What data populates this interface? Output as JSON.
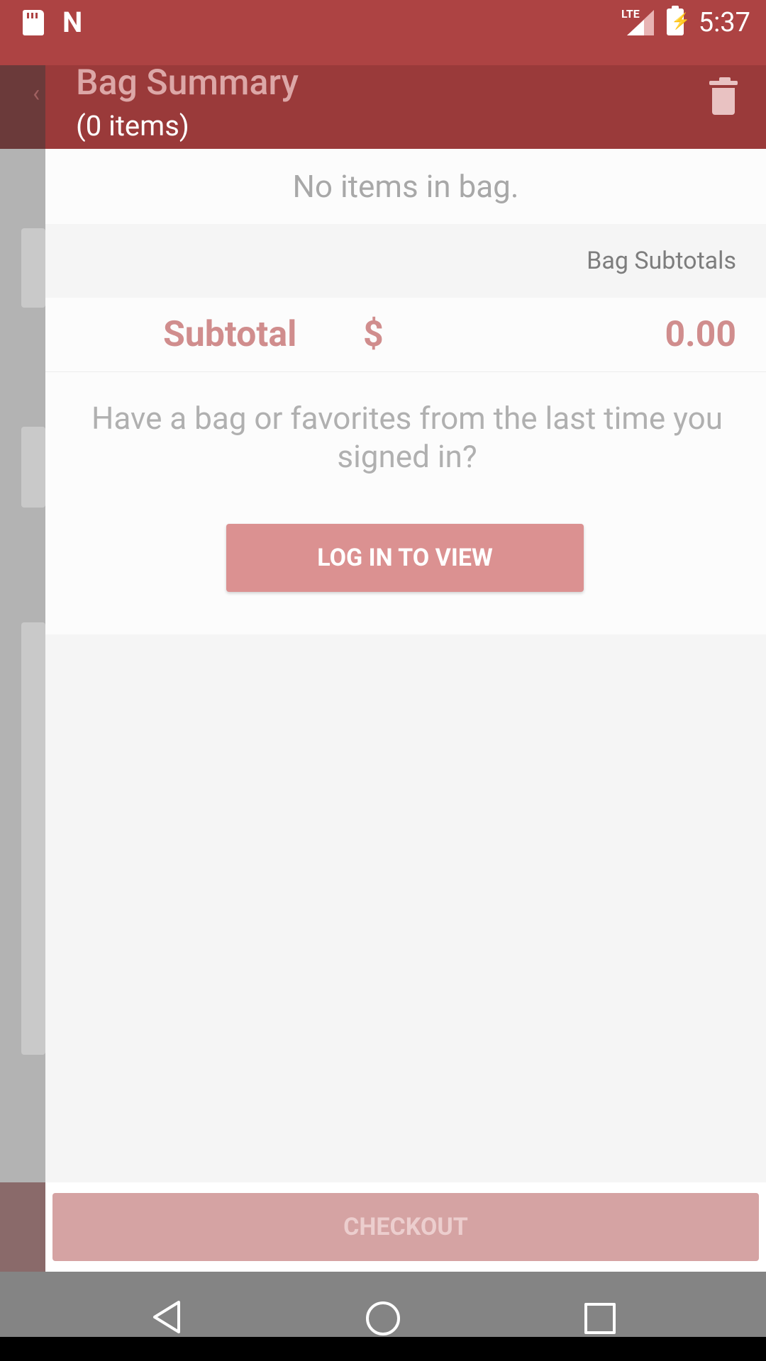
{
  "status_bar": {
    "network": "LTE",
    "time": "5:37"
  },
  "bag": {
    "title": "Bag Summary",
    "item_count_label": "(0 items)",
    "empty_message": "No items in bag.",
    "subtotals_header": "Bag Subtotals",
    "subtotal_label": "Subtotal",
    "currency_symbol": "$",
    "subtotal_value": "0.00"
  },
  "login_prompt": {
    "message": "Have a bag or favorites from the last time you signed in?",
    "button_label": "LOG IN TO VIEW"
  },
  "footer": {
    "checkout_label": "CHECKOUT"
  },
  "colors": {
    "status_bar": "#ad4343",
    "accent": "#db9191",
    "subtotal_text": "#d08d8d",
    "checkout_disabled": "#d5a3a3"
  },
  "icons": {
    "status_bar": [
      "sd-card-icon",
      "notification-n-icon",
      "signal-icon",
      "battery-charging-icon"
    ],
    "header": [
      "trash-icon"
    ],
    "nav": [
      "back-icon",
      "home-icon",
      "recent-apps-icon"
    ]
  }
}
